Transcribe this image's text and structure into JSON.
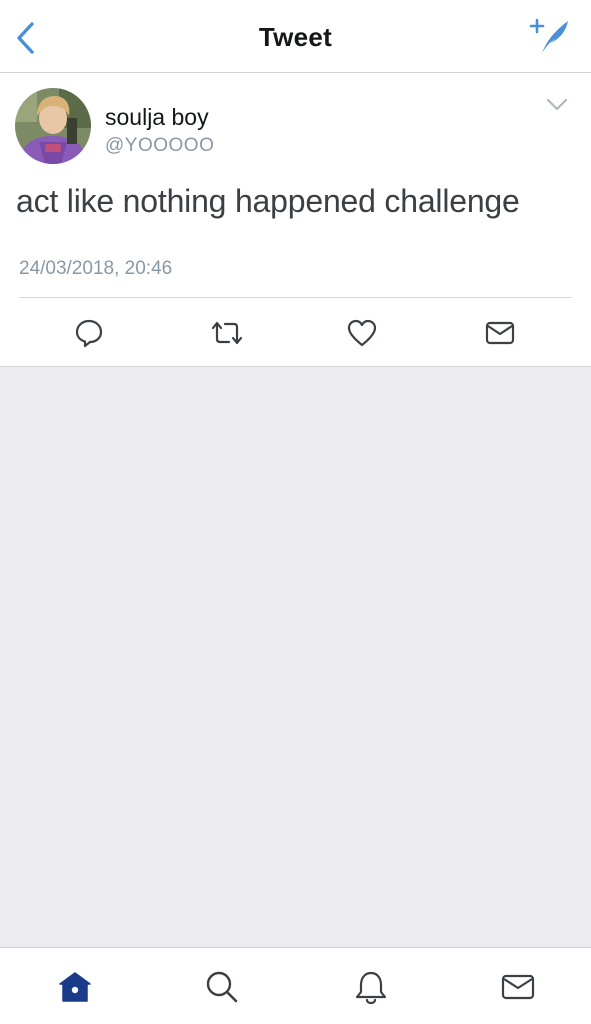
{
  "nav": {
    "title": "Tweet",
    "back_icon": "back-chevron-icon",
    "compose_icon": "compose-tweet-icon",
    "accent_color": "#4a90d9"
  },
  "tweet": {
    "author_name": "soulja boy",
    "author_handle": "@YOOOOO",
    "text": "act like nothing happened challenge",
    "timestamp": "24/03/2018, 20:46",
    "avatar_icon": "profile-avatar",
    "menu_icon": "chevron-down-icon",
    "actions": [
      {
        "name": "reply",
        "icon": "reply-icon"
      },
      {
        "name": "retweet",
        "icon": "retweet-icon"
      },
      {
        "name": "like",
        "icon": "heart-icon"
      },
      {
        "name": "direct-message",
        "icon": "envelope-icon"
      }
    ]
  },
  "tab_bar": {
    "active_color": "#1a3a8a",
    "inactive_color": "#3b4045",
    "tabs": [
      {
        "name": "home",
        "icon": "home-icon",
        "active": true
      },
      {
        "name": "search",
        "icon": "search-icon",
        "active": false
      },
      {
        "name": "notifications",
        "icon": "bell-icon",
        "active": false
      },
      {
        "name": "messages",
        "icon": "envelope-icon",
        "active": false
      }
    ]
  },
  "colors": {
    "background": "#ebebf0",
    "card": "#ffffff",
    "text_primary": "#14171a",
    "text_secondary": "#8899a6",
    "icon_gray": "#657786"
  }
}
